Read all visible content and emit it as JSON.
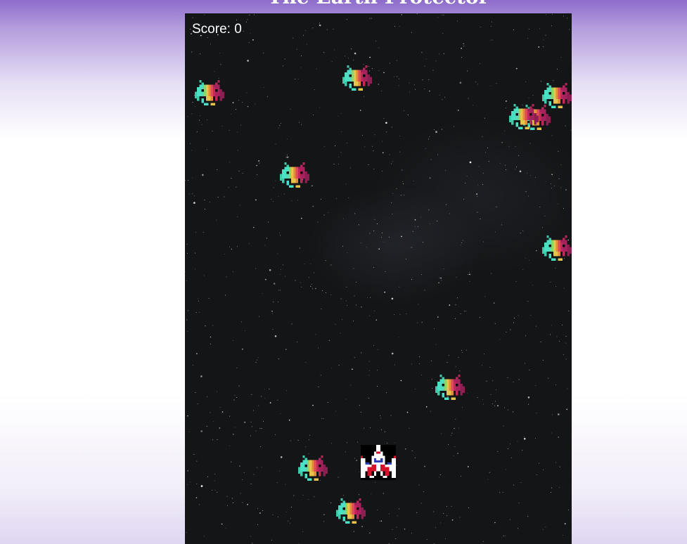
{
  "page": {
    "title": "The Earth Protector"
  },
  "hud": {
    "score_label": "Score: 0"
  },
  "game": {
    "background": "starfield",
    "player_icon": "fighter-ship-icon",
    "enemy_icon": "alien-invader-icon",
    "enemy_count": 10
  }
}
